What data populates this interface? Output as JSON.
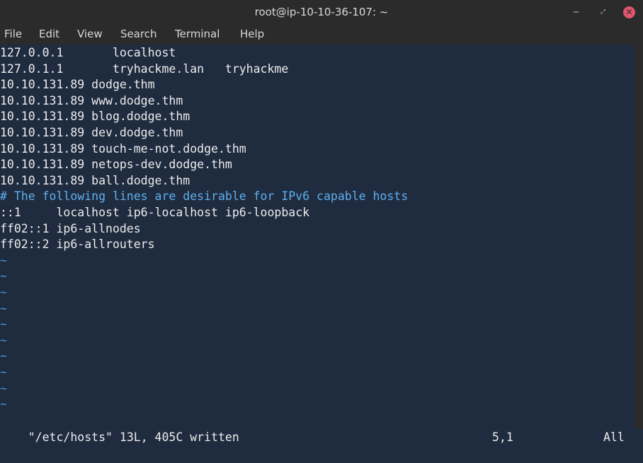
{
  "window": {
    "title": "root@ip-10-10-36-107: ~"
  },
  "window_controls": {
    "minimize": "‒",
    "maximize": "⤢",
    "close": "✕"
  },
  "menu": [
    "File",
    "Edit",
    "View",
    "Search",
    "Terminal",
    "Help"
  ],
  "terminal": {
    "lines": [
      "127.0.0.1       localhost",
      "127.0.1.1       tryhackme.lan   tryhackme",
      "10.10.131.89 dodge.thm",
      "10.10.131.89 www.dodge.thm",
      "10.10.131.89 blog.dodge.thm",
      "10.10.131.89 dev.dodge.thm",
      "10.10.131.89 touch-me-not.dodge.thm",
      "10.10.131.89 netops-dev.dodge.thm",
      "10.10.131.89 ball.dodge.thm",
      "# The following lines are desirable for IPv6 capable hosts",
      "::1     localhost ip6-localhost ip6-loopback",
      "ff02::1 ip6-allnodes",
      "ff02::2 ip6-allrouters"
    ],
    "tilde": "~",
    "tilde_count": 10
  },
  "status": {
    "message": "\"/etc/hosts\" 13L, 405C written",
    "position": "5,1",
    "percent": "All"
  }
}
